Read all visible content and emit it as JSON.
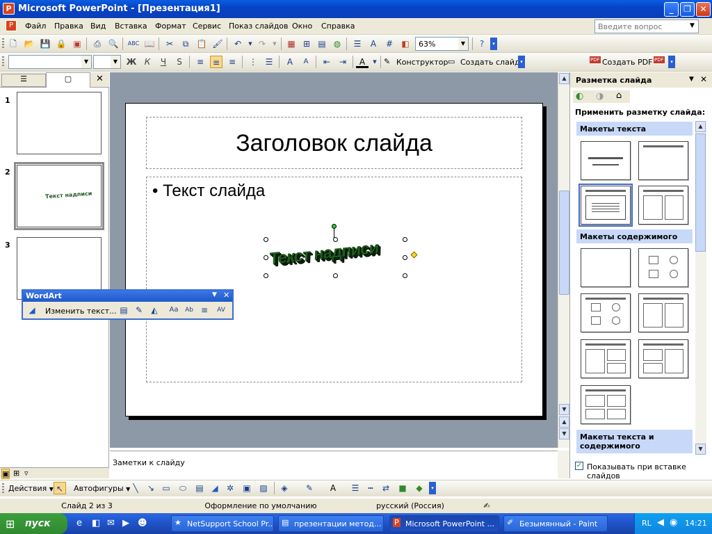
{
  "window": {
    "title": "Microsoft PowerPoint - [Презентация1]",
    "min": "_",
    "restore": "❐",
    "close": "✕"
  },
  "menu": {
    "items": [
      "Файл",
      "Правка",
      "Вид",
      "Вставка",
      "Формат",
      "Сервис",
      "Показ слайдов",
      "Окно",
      "Справка"
    ],
    "help_placeholder": "Введите вопрос"
  },
  "toolbar": {
    "zoom": "63%"
  },
  "format_toolbar": {
    "bold": "Ж",
    "italic": "К",
    "underline": "Ч",
    "shadow": "S",
    "designer": "Конструктор",
    "create_slide": "Создать слайд",
    "create_pdf": "Создать PDF"
  },
  "slides_panel": {
    "numbers": [
      "1",
      "2",
      "3"
    ],
    "selected": 2
  },
  "slide": {
    "title": "Заголовок слайда",
    "bullet": "Текст слайда",
    "wordart_text": "Текст надписи",
    "wordart_color": "#1f5a1f"
  },
  "notes": {
    "placeholder": "Заметки к слайду"
  },
  "task_pane": {
    "title": "Разметка слайда",
    "apply_label": "Применить разметку слайда:",
    "sections": [
      "Макеты текста",
      "Макеты содержимого",
      "Макеты текста и содержимого"
    ],
    "checkbox_label": "Показывать при вставке слайдов",
    "checkbox_checked": true
  },
  "wordart_toolbar": {
    "title": "WordArt",
    "edit_text": "Изменить текст..."
  },
  "draw_toolbar": {
    "actions": "Действия",
    "autoshapes": "Автофигуры"
  },
  "status": {
    "slide": "Слайд 2 из 3",
    "design": "Оформление по умолчанию",
    "language": "русский (Россия)"
  },
  "taskbar": {
    "start": "пуск",
    "buttons": [
      "NetSupport School Pr...",
      "презентации метод...",
      "Microsoft PowerPoint ...",
      "Безымянный - Paint"
    ],
    "active_index": 2,
    "lang": "RL",
    "clock": "14:21"
  }
}
